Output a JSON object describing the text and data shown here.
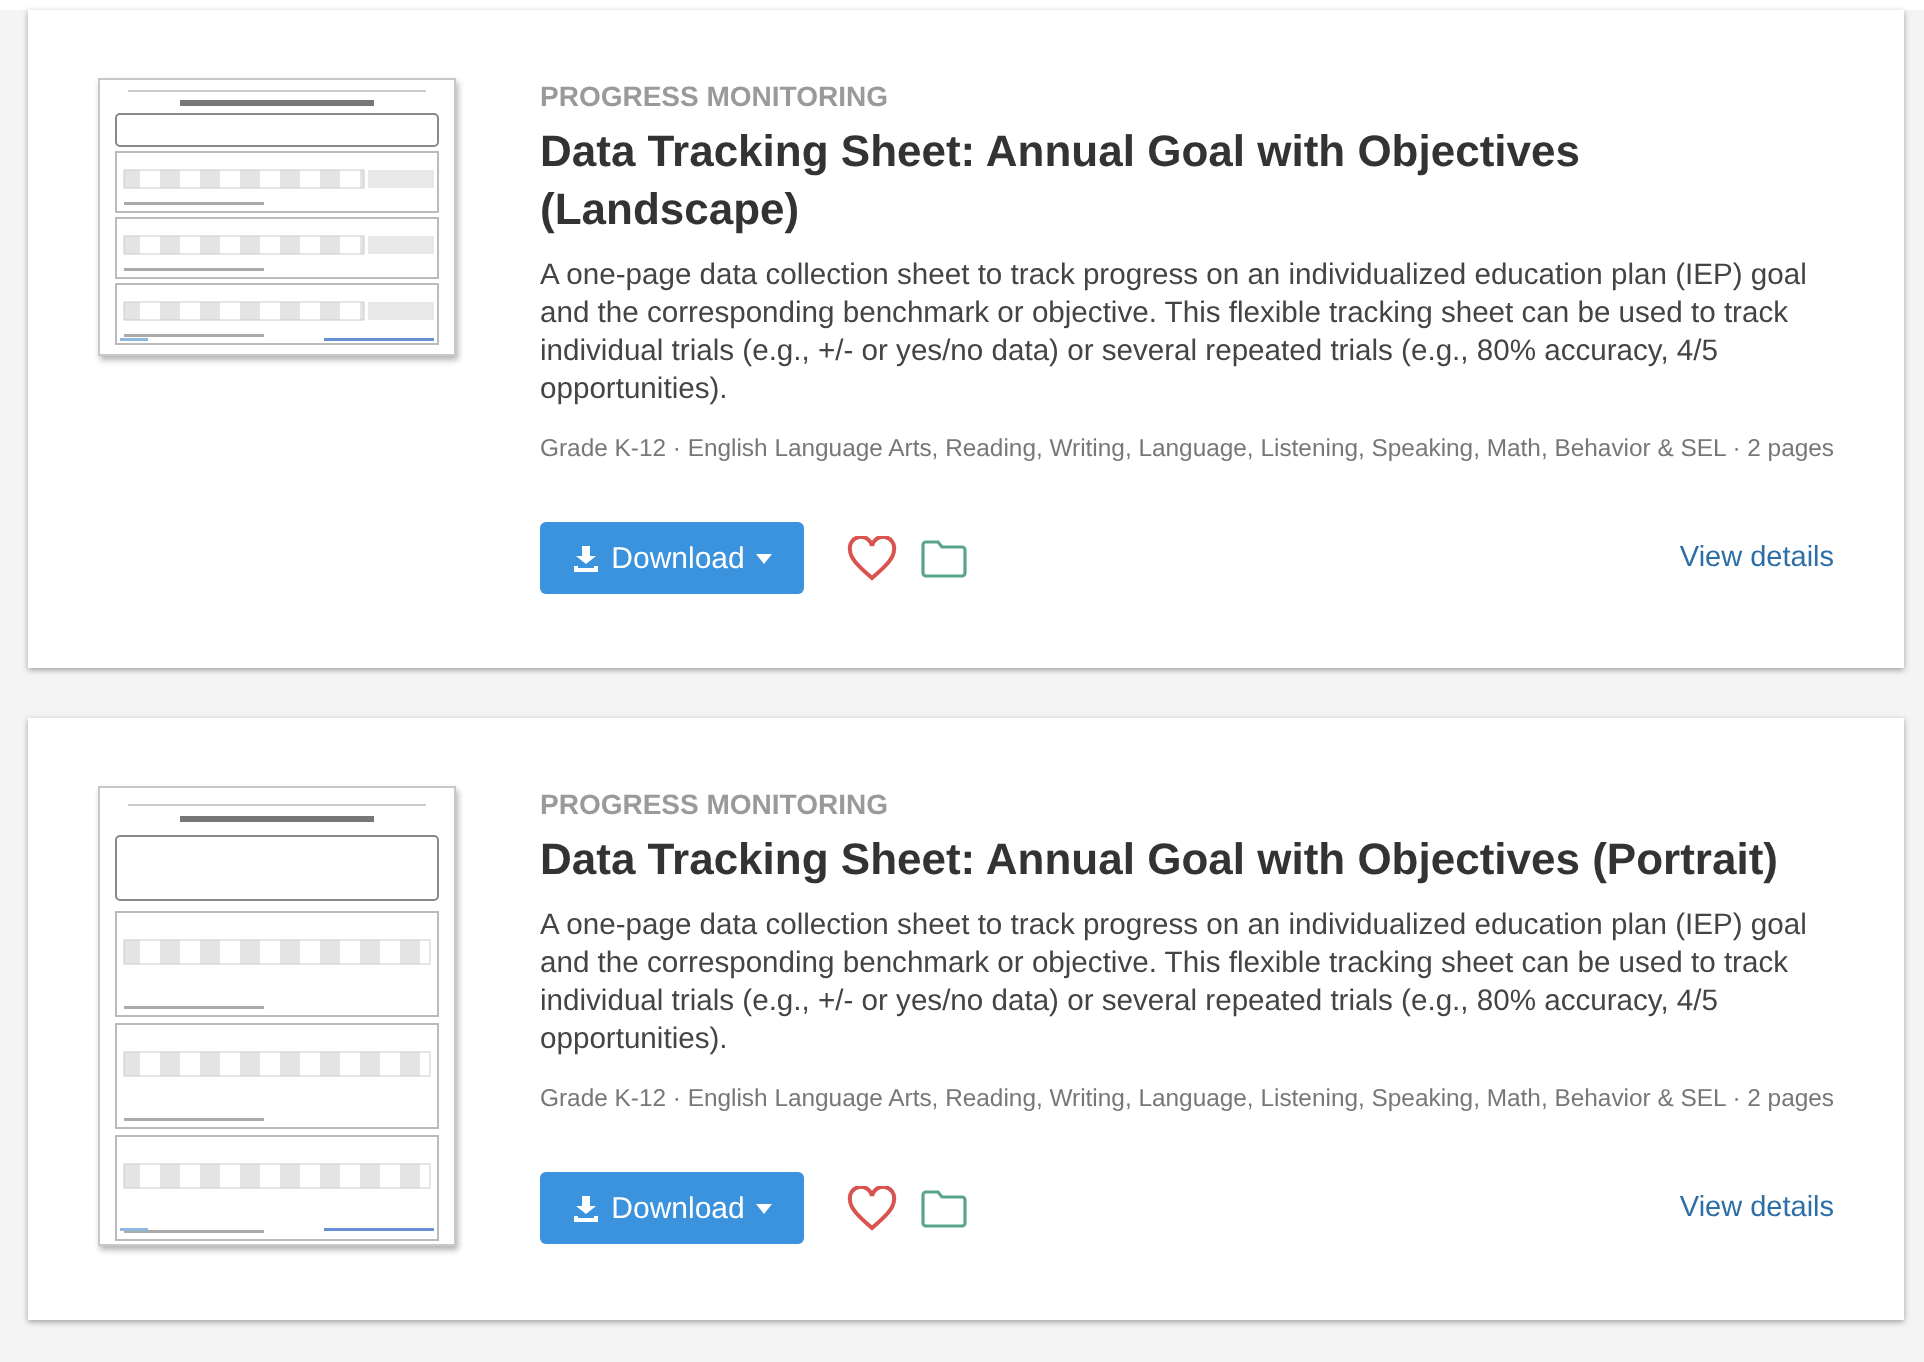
{
  "resources": [
    {
      "category": "PROGRESS MONITORING",
      "title": "Data Tracking Sheet: Annual Goal with Objectives (Landscape)",
      "description": "A one-page data collection sheet to track progress on an individualized education plan (IEP) goal and the corresponding benchmark or objective. This flexible tracking sheet can be used to track individual trials (e.g., +/- or yes/no data) or several repeated trials (e.g., 80% accuracy, 4/5 opportunities).",
      "meta": "Grade K-12 · English Language Arts, Reading, Writing, Language, Listening, Speaking, Math, Behavior & SEL · 2 pages",
      "download": "Download",
      "favorited": false,
      "link": "View details",
      "preview": {
        "kind": "picture",
        "portrait": false
      }
    },
    {
      "category": "PROGRESS MONITORING",
      "title": "Data Tracking Sheet: Annual Goal with Objectives (Portrait)",
      "description": "A one-page data collection sheet to track progress on an individualized education plan (IEP) goal and the corresponding benchmark or objective. This flexible tracking sheet can be used to track individual trials (e.g., +/- or yes/no data) or several repeated trials (e.g., 80% accuracy, 4/5 opportunities).",
      "meta": "Grade K-12 · English Language Arts, Reading, Writing, Language, Listening, Speaking, Math, Behavior & SEL · 2 pages",
      "download": "Download",
      "favorited": false,
      "link": "View details",
      "preview": {
        "kind": "picture",
        "portrait": true
      }
    }
  ]
}
